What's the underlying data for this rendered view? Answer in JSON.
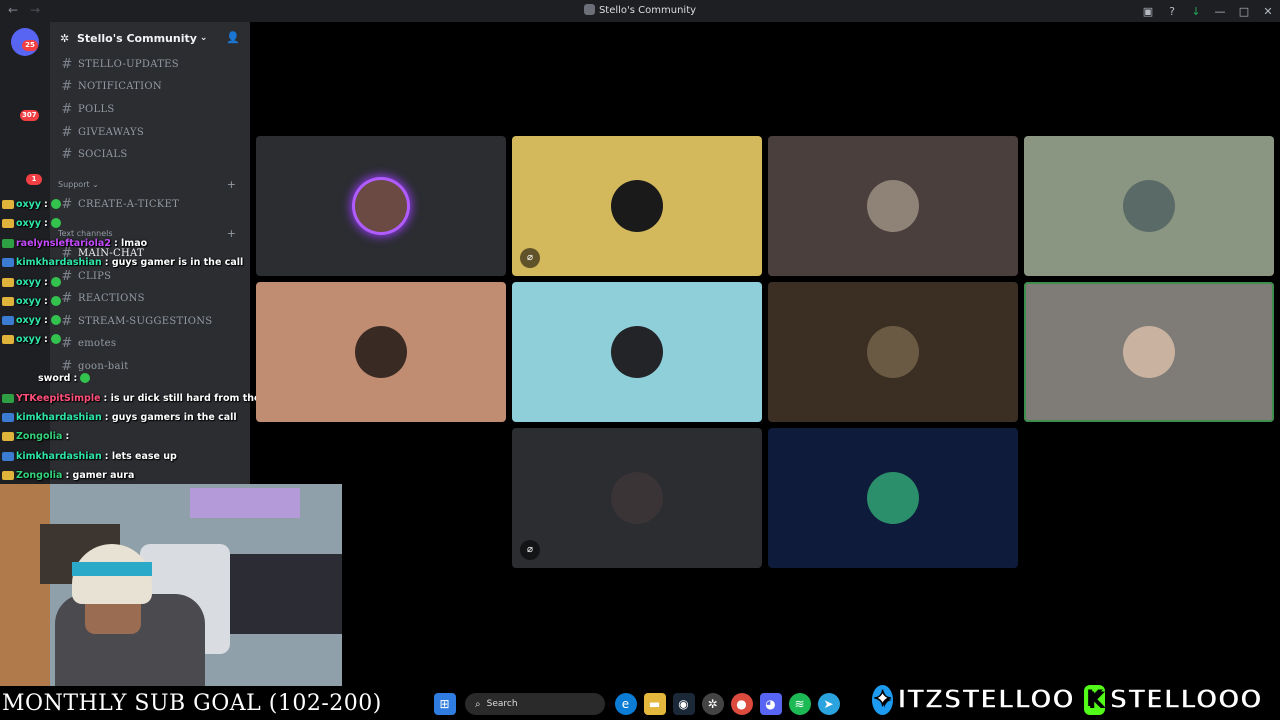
{
  "titlebar": {
    "title": "Stello's Community"
  },
  "rail": {
    "servers": [
      {
        "badge": "25",
        "color": "#5865f2"
      },
      {
        "badge": "",
        "color": "#8a6c5a"
      },
      {
        "badge": "307",
        "color": "#3a7bd5"
      },
      {
        "badge": "",
        "color": "#e0c060"
      },
      {
        "badge": "1",
        "color": "#b23a3a"
      }
    ]
  },
  "sidebar": {
    "server_name": "Stello's Community",
    "channels_top": [
      "STELLO-UPDATES",
      "NOTIFICATION",
      "POLLS",
      "GIVEAWAYS",
      "SOCIALS"
    ],
    "category_support": "Support",
    "channel_ticket": "CREATE-A-TICKET",
    "category_text": "Text channels",
    "channels_text": [
      "MAIN-CHAT",
      "CLIPS",
      "REACTIONS",
      "STREAM-SUGGESTIONS",
      "emotes",
      "goon-bait"
    ]
  },
  "chat": {
    "messages": [
      {
        "user": "oxyy",
        "text": "",
        "color": "#2ee6a8"
      },
      {
        "user": "oxyy",
        "text": "",
        "color": "#2ee6a8"
      },
      {
        "user": "raelynsleftariola2",
        "text": ": lmao",
        "color": "#c64bff"
      },
      {
        "user": "kimkhardashian",
        "text": ": guys gamer is in the call",
        "color": "#2ee6a8"
      },
      {
        "user": "oxyy",
        "text": "",
        "color": "#2ee6a8"
      },
      {
        "user": "oxyy",
        "text": "",
        "color": "#2ee6a8"
      },
      {
        "user": "oxyy",
        "text": "",
        "color": "#2ee6a8"
      },
      {
        "user": "oxyy",
        "text": "",
        "color": "#2ee6a8"
      },
      {
        "user": "sword",
        "text": "",
        "color": "#ffffff"
      },
      {
        "user": "YTKeepitSimple",
        "text": ": is ur dick still hard from the rhino",
        "color": "#ff4f7a"
      },
      {
        "user": "kimkhardashian",
        "text": ": guys gamers in the call",
        "color": "#2ee6a8"
      },
      {
        "user": "Zongolia",
        "text": "",
        "color": "#33d17a"
      },
      {
        "user": "kimkhardashian",
        "text": ": lets ease up",
        "color": "#2ee6a8"
      },
      {
        "user": "Zongolia",
        "text": ": gamer aura",
        "color": "#33d17a"
      }
    ]
  },
  "voice": {
    "tiles": [
      {
        "bg": "#2b2d31",
        "avatar": "#6b4a44",
        "mute": false,
        "ring": true,
        "speaking": false
      },
      {
        "bg": "#d4b95c",
        "avatar": "#1a1a1a",
        "mute": true,
        "ring": false,
        "speaking": false
      },
      {
        "bg": "#4a3f3c",
        "avatar": "#8f8378",
        "mute": false,
        "ring": false,
        "speaking": false
      },
      {
        "bg": "#8a9582",
        "avatar": "#5a6a66",
        "mute": false,
        "ring": false,
        "speaking": false
      },
      {
        "bg": "#c08c72",
        "avatar": "#3a2a24",
        "mute": false,
        "ring": false,
        "speaking": false
      },
      {
        "bg": "#8fcfda",
        "avatar": "#222428",
        "mute": false,
        "ring": false,
        "speaking": false
      },
      {
        "bg": "#3a2f22",
        "avatar": "#6a5a44",
        "mute": false,
        "ring": false,
        "speaking": false
      },
      {
        "bg": "#7f7b76",
        "avatar": "#c9b2a0",
        "mute": false,
        "ring": false,
        "speaking": true
      },
      {
        "bg": "#2b2d31",
        "avatar": "#3a3436",
        "mute": true,
        "ring": false,
        "speaking": false
      },
      {
        "bg": "#0f1b3a",
        "avatar": "#2a8f6a",
        "mute": false,
        "ring": false,
        "speaking": false
      }
    ]
  },
  "overlay": {
    "sub_goal": "MONTHLY SUB GOAL (102-200)",
    "twitter_handle": "ITZSTELLOO",
    "kick_handle": "STELLOOO",
    "kick_letter": "K"
  },
  "taskbar": {
    "search_label": "Search"
  }
}
